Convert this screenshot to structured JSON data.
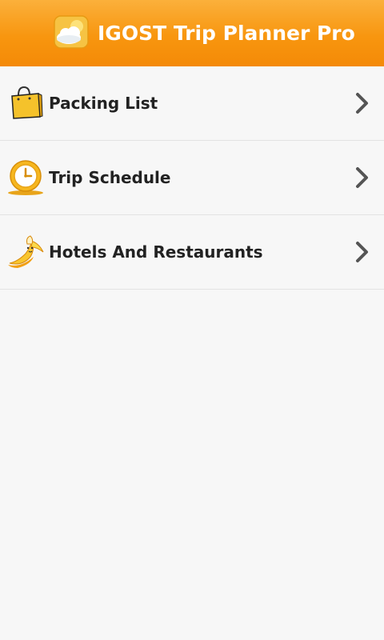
{
  "header": {
    "title": "IGOST Trip Planner Pro",
    "logo_icon": "cloud-sun-icon"
  },
  "menu": {
    "items": [
      {
        "label": "Packing List",
        "icon": "shopping-bag-icon"
      },
      {
        "label": "Trip Schedule",
        "icon": "clock-icon"
      },
      {
        "label": "Hotels And Restaurants",
        "icon": "banana-icon"
      }
    ]
  },
  "colors": {
    "header_top": "#fbb03b",
    "header_bottom": "#f48a07",
    "background": "#f7f7f7",
    "divider": "#e3e3e3",
    "text": "#222222",
    "chevron": "#555555"
  }
}
